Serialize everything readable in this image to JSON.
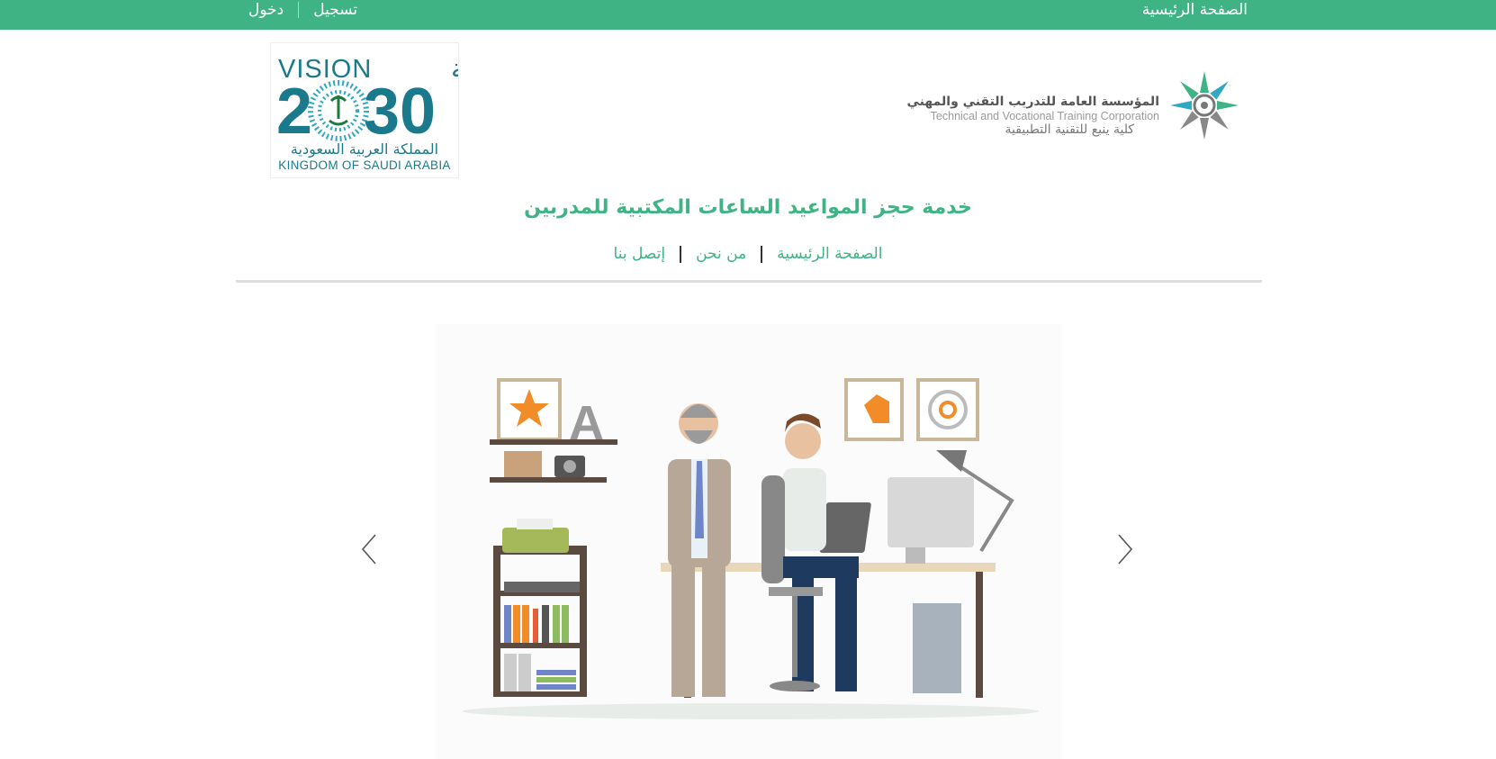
{
  "topbar": {
    "home_label": "الصفحة الرئيسية",
    "register_label": "تسجيل",
    "login_label": "دخول",
    "background_color": "#3fb383"
  },
  "vision_logo": {
    "arabic_word": "رؤيـــة",
    "english_word": "VISION",
    "year_left": "2",
    "year_right": "30",
    "kingdom_ar": "المملكة العربية السعودية",
    "kingdom_en": "KINGDOM OF SAUDI ARABIA",
    "color": "#1a7a8c"
  },
  "corp_logo": {
    "arabic_name": "المؤسسة العامة للتدريب التقني والمهني",
    "english_name": "Technical and Vocational Training Corporation",
    "college_name": "كلية ينبع للتقنية التطبيقية"
  },
  "service_title": "خدمة حجز المواعيد الساعات المكتبية للمدربين",
  "nav": {
    "items": [
      "الصفحة الرئيسية",
      "من نحن",
      "إتصل بنا"
    ]
  },
  "carousel": {
    "prev_icon": "chevron-left-icon",
    "next_icon": "chevron-right-icon",
    "slide_image": "office-illustration"
  },
  "colors": {
    "accent": "#3fb383",
    "divider": "#dedede"
  }
}
